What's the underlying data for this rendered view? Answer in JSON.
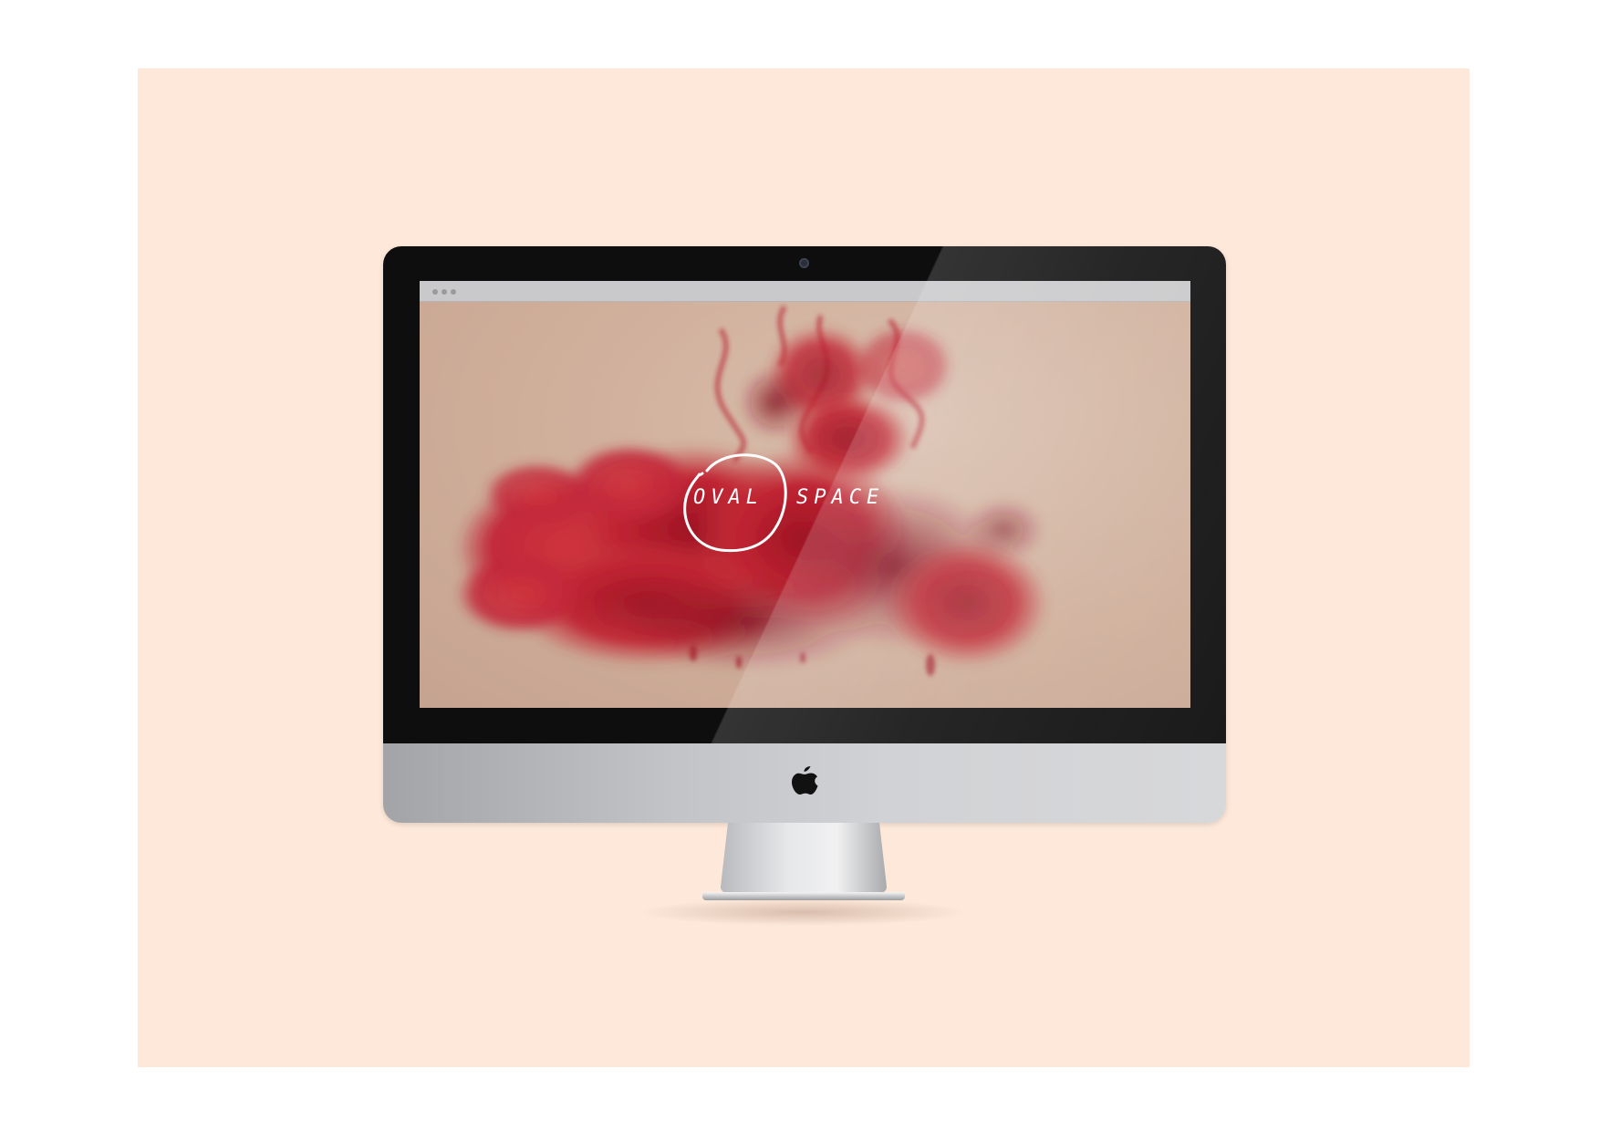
{
  "scene": {
    "backdrop_color": "#fde8d9",
    "device": "imac"
  },
  "browser": {
    "window_controls": [
      "dot",
      "dot",
      "dot"
    ]
  },
  "website": {
    "logo": {
      "word_left": "OVAL",
      "word_right": "SPACE",
      "mark": "hand-drawn-circle"
    },
    "hero_image": "red-ink-cloud",
    "accent_color": "#c0232f"
  },
  "device_branding": {
    "icon": "apple-logo-icon"
  }
}
